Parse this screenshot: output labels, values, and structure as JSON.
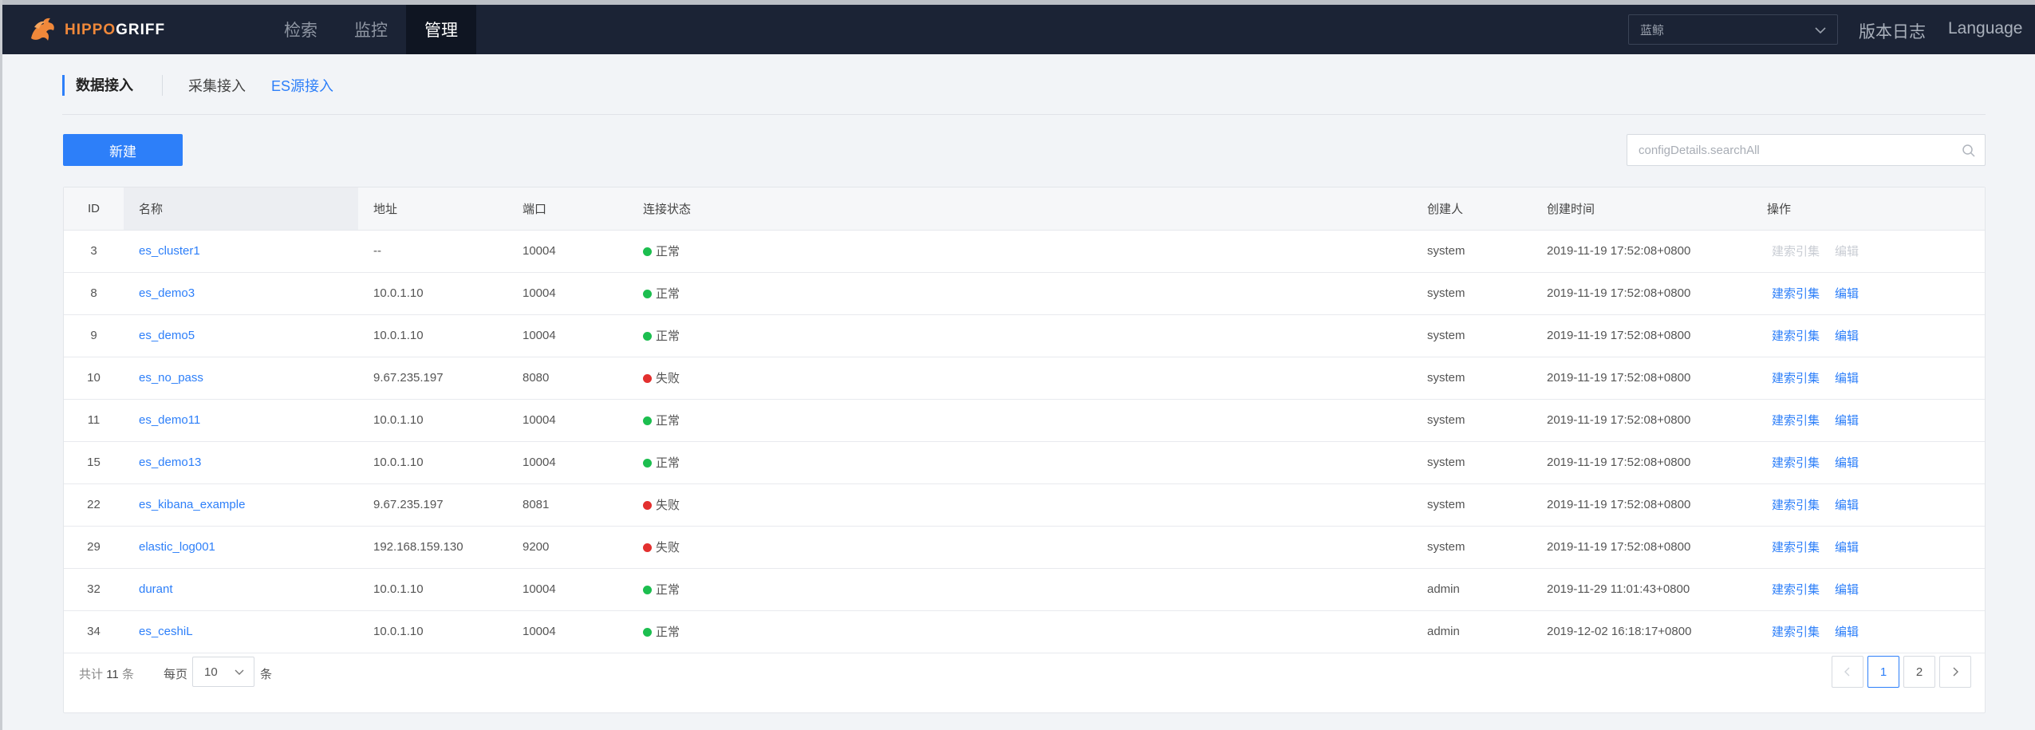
{
  "app": {
    "logo_part1": "HIPPO",
    "logo_part2": "GRIFF",
    "brand_color": "#f0883a"
  },
  "nav": {
    "items": [
      {
        "label": "检索",
        "active": false
      },
      {
        "label": "监控",
        "active": false
      },
      {
        "label": "管理",
        "active": true
      }
    ],
    "region_value": "蓝鲸",
    "changelog": "版本日志",
    "language": "Language"
  },
  "subnav": {
    "title": "数据接入",
    "tabs": [
      {
        "label": "采集接入",
        "active": false
      },
      {
        "label": "ES源接入",
        "active": true
      }
    ]
  },
  "toolbar": {
    "new_button": "新建",
    "search_placeholder": "configDetails.searchAll"
  },
  "table": {
    "columns": [
      "ID",
      "名称",
      "地址",
      "端口",
      "连接状态",
      "创建人",
      "创建时间",
      "操作"
    ],
    "rows": [
      {
        "id": "3",
        "name": "es_cluster1",
        "address": "--",
        "port": "10004",
        "status": "正常",
        "ok": true,
        "creator": "system",
        "created": "2019-11-19 17:52:08+0800",
        "ops_disabled": true
      },
      {
        "id": "8",
        "name": "es_demo3",
        "address": "10.0.1.10",
        "port": "10004",
        "status": "正常",
        "ok": true,
        "creator": "system",
        "created": "2019-11-19 17:52:08+0800",
        "ops_disabled": false
      },
      {
        "id": "9",
        "name": "es_demo5",
        "address": "10.0.1.10",
        "port": "10004",
        "status": "正常",
        "ok": true,
        "creator": "system",
        "created": "2019-11-19 17:52:08+0800",
        "ops_disabled": false
      },
      {
        "id": "10",
        "name": "es_no_pass",
        "address": "9.67.235.197",
        "port": "8080",
        "status": "失败",
        "ok": false,
        "creator": "system",
        "created": "2019-11-19 17:52:08+0800",
        "ops_disabled": false
      },
      {
        "id": "11",
        "name": "es_demo11",
        "address": "10.0.1.10",
        "port": "10004",
        "status": "正常",
        "ok": true,
        "creator": "system",
        "created": "2019-11-19 17:52:08+0800",
        "ops_disabled": false
      },
      {
        "id": "15",
        "name": "es_demo13",
        "address": "10.0.1.10",
        "port": "10004",
        "status": "正常",
        "ok": true,
        "creator": "system",
        "created": "2019-11-19 17:52:08+0800",
        "ops_disabled": false
      },
      {
        "id": "22",
        "name": "es_kibana_example",
        "address": "9.67.235.197",
        "port": "8081",
        "status": "失败",
        "ok": false,
        "creator": "system",
        "created": "2019-11-19 17:52:08+0800",
        "ops_disabled": false
      },
      {
        "id": "29",
        "name": "elastic_log001",
        "address": "192.168.159.130",
        "port": "9200",
        "status": "失败",
        "ok": false,
        "creator": "system",
        "created": "2019-11-19 17:52:08+0800",
        "ops_disabled": false
      },
      {
        "id": "32",
        "name": "durant",
        "address": "10.0.1.10",
        "port": "10004",
        "status": "正常",
        "ok": true,
        "creator": "admin",
        "created": "2019-11-29 11:01:43+0800",
        "ops_disabled": false
      },
      {
        "id": "34",
        "name": "es_ceshiL",
        "address": "10.0.1.10",
        "port": "10004",
        "status": "正常",
        "ok": true,
        "creator": "admin",
        "created": "2019-12-02 16:18:17+0800",
        "ops_disabled": false
      }
    ],
    "op_index_label": "建索引集",
    "op_edit_label": "编辑"
  },
  "pagination": {
    "total_prefix": "共计",
    "total_count": "11",
    "total_suffix": "条",
    "per_page_label": "每页",
    "per_page_value": "10",
    "per_page_unit": "条",
    "pages": [
      "1",
      "2"
    ],
    "current_page": "1"
  }
}
